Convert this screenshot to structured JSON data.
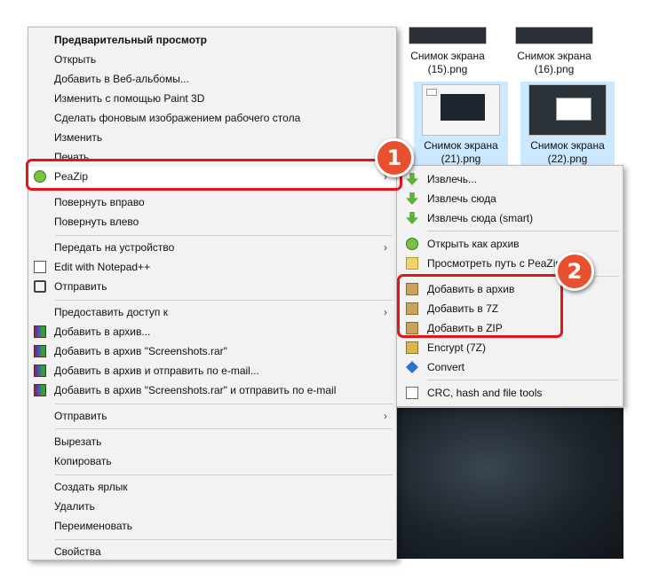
{
  "main_menu": {
    "items": [
      {
        "label": "Предварительный просмотр",
        "icon": null,
        "bold": true
      },
      {
        "label": "Открыть",
        "icon": null
      },
      {
        "label": "Добавить в Веб-альбомы...",
        "icon": null
      },
      {
        "label": "Изменить с помощью Paint 3D",
        "icon": null
      },
      {
        "label": "Сделать фоновым изображением рабочего стола",
        "icon": null
      },
      {
        "label": "Изменить",
        "icon": null
      },
      {
        "label": "Печать",
        "icon": null
      },
      {
        "label": "PeaZip",
        "icon": "peazip-icon",
        "submenu": true
      },
      {
        "label": "Повернуть вправо",
        "icon": null
      },
      {
        "label": "Повернуть влево",
        "icon": null
      },
      {
        "label": "Передать на устройство",
        "icon": null,
        "submenu": true
      },
      {
        "label": "Edit with Notepad++",
        "icon": "notepad-icon"
      },
      {
        "label": "Отправить",
        "icon": "share-icon"
      },
      {
        "label": "Предоставить доступ к",
        "icon": null,
        "submenu": true
      },
      {
        "label": "Добавить в архив...",
        "icon": "winrar-icon"
      },
      {
        "label": "Добавить в архив \"Screenshots.rar\"",
        "icon": "winrar-icon"
      },
      {
        "label": "Добавить в архив и отправить по e-mail...",
        "icon": "winrar-icon"
      },
      {
        "label": "Добавить в архив \"Screenshots.rar\" и отправить по e-mail",
        "icon": "winrar-icon"
      },
      {
        "label": "Отправить",
        "icon": null,
        "submenu": true
      },
      {
        "label": "Вырезать",
        "icon": null
      },
      {
        "label": "Копировать",
        "icon": null
      },
      {
        "label": "Создать ярлык",
        "icon": null
      },
      {
        "label": "Удалить",
        "icon": null
      },
      {
        "label": "Переименовать",
        "icon": null
      },
      {
        "label": "Свойства",
        "icon": null
      }
    ],
    "submenu_arrow": "›"
  },
  "sub_menu": {
    "items": [
      {
        "label": "Извлечь...",
        "icon": "extract-icon"
      },
      {
        "label": "Извлечь сюда",
        "icon": "extract-icon"
      },
      {
        "label": "Извлечь сюда (smart)",
        "icon": "extract-icon"
      },
      {
        "label": "Открыть как архив",
        "icon": "peazip-icon"
      },
      {
        "label": "Просмотреть путь с PeaZip",
        "icon": "folder-icon"
      },
      {
        "label": "Добавить в архив",
        "icon": "add-archive-icon"
      },
      {
        "label": "Добавить в 7Z",
        "icon": "add-archive-icon"
      },
      {
        "label": "Добавить в ZIP",
        "icon": "add-archive-icon"
      },
      {
        "label": "Encrypt (7Z)",
        "icon": "encrypt-icon"
      },
      {
        "label": "Convert",
        "icon": "convert-icon"
      },
      {
        "label": "CRC, hash and file tools",
        "icon": "crc-icon"
      }
    ]
  },
  "thumbnails": [
    {
      "name_line1": "Снимок экрана",
      "name_line2": "(15).png",
      "selected": false
    },
    {
      "name_line1": "Снимок экрана",
      "name_line2": "(16).png",
      "selected": false
    },
    {
      "name_line1": "Снимок экрана",
      "name_line2": "(21).png",
      "selected": true
    },
    {
      "name_line1": "Снимок экрана",
      "name_line2": "(22).png",
      "selected": true
    }
  ],
  "badges": [
    "1",
    "2"
  ],
  "colors": {
    "highlight": "#e2141c",
    "badge": "#e8512f",
    "selection": "#cce8ff"
  }
}
